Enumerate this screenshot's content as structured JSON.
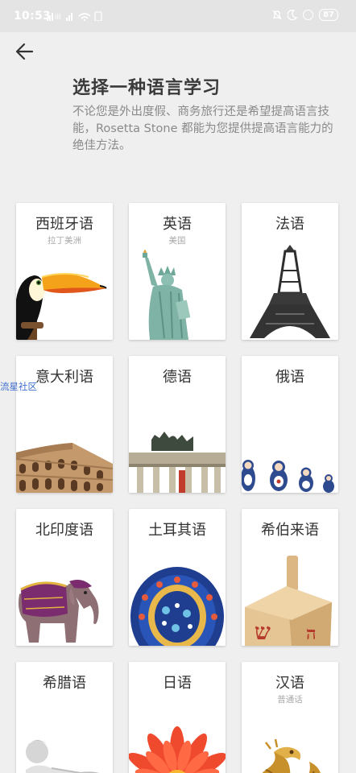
{
  "status": {
    "time": "10:53",
    "battery": "87"
  },
  "header": {
    "title": "选择一种语言学习",
    "description": "不论您是外出度假、商务旅行还是希望提高语言技能，Rosetta Stone 都能为您提供提高语言能力的绝佳方法。"
  },
  "watermark": "流星社区",
  "languages": [
    {
      "name": "西班牙语",
      "sub": "拉丁美洲",
      "icon": "toucan-image"
    },
    {
      "name": "英语",
      "sub": "美国",
      "icon": "statue-of-liberty-image"
    },
    {
      "name": "法语",
      "sub": "",
      "icon": "eiffel-tower-image"
    },
    {
      "name": "意大利语",
      "sub": "",
      "icon": "colosseum-image"
    },
    {
      "name": "德语",
      "sub": "",
      "icon": "brandenburg-gate-image"
    },
    {
      "name": "俄语",
      "sub": "",
      "icon": "matryoshka-dolls-image"
    },
    {
      "name": "北印度语",
      "sub": "",
      "icon": "elephant-image"
    },
    {
      "name": "土耳其语",
      "sub": "",
      "icon": "decorative-plate-image"
    },
    {
      "name": "希伯来语",
      "sub": "",
      "icon": "dreidel-image"
    },
    {
      "name": "希腊语",
      "sub": "",
      "icon": "greek-statue-image"
    },
    {
      "name": "日语",
      "sub": "",
      "icon": "gerbera-flower-image"
    },
    {
      "name": "汉语",
      "sub": "普通话",
      "icon": "golden-dragon-image"
    }
  ]
}
